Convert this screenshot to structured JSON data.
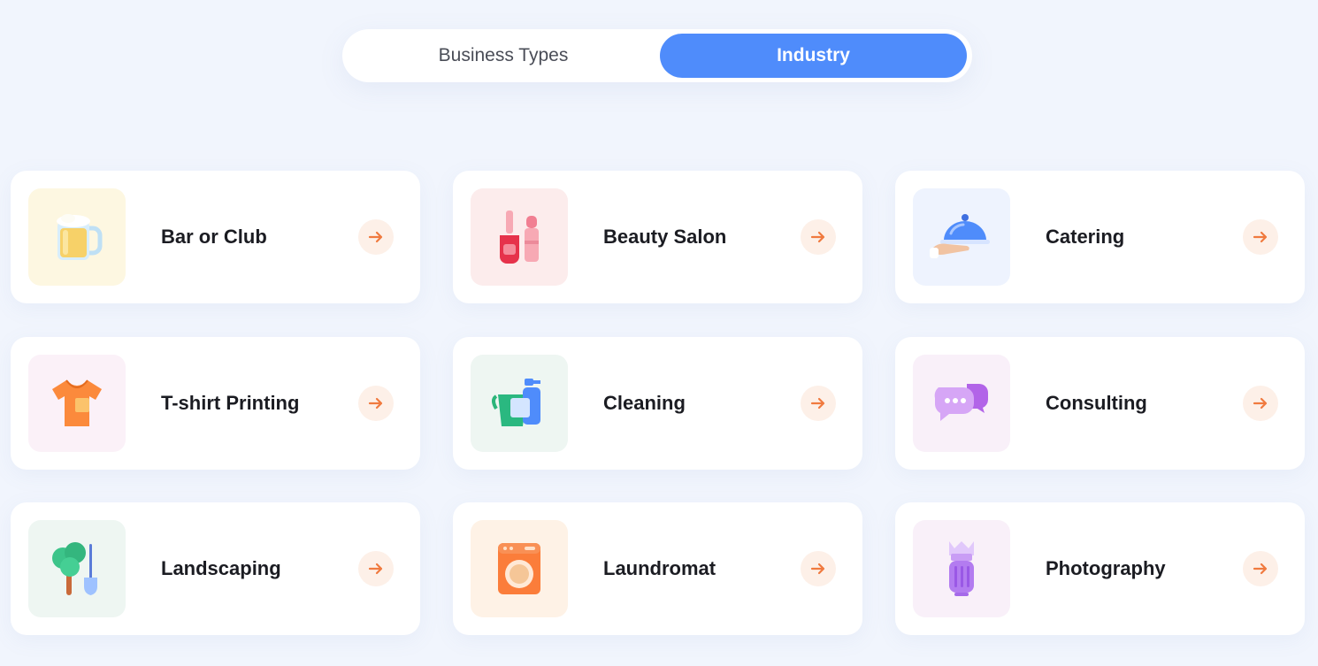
{
  "toggle": {
    "tabs": [
      {
        "label": "Business Types",
        "active": false
      },
      {
        "label": "Industry",
        "active": true
      }
    ],
    "active_color": "#4f8cfb"
  },
  "accent_arrow_color": "#f07a3f",
  "cards": [
    {
      "label": "Bar or Club",
      "icon": "beer-mug-icon",
      "tile_color": "#fdf7e1"
    },
    {
      "label": "Beauty Salon",
      "icon": "nail-polish-lipstick-icon",
      "tile_color": "#fcecec"
    },
    {
      "label": "Catering",
      "icon": "serving-cloche-icon",
      "tile_color": "#eef3fe"
    },
    {
      "label": "T-shirt Printing",
      "icon": "tshirt-icon",
      "tile_color": "#fbf1f8"
    },
    {
      "label": "Cleaning",
      "icon": "cleaning-bucket-spray-icon",
      "tile_color": "#eef6f2"
    },
    {
      "label": "Consulting",
      "icon": "chat-bubbles-icon",
      "tile_color": "#f9f0f9"
    },
    {
      "label": "Landscaping",
      "icon": "tree-shovel-icon",
      "tile_color": "#eef6f2"
    },
    {
      "label": "Laundromat",
      "icon": "washing-machine-icon",
      "tile_color": "#fef2e6"
    },
    {
      "label": "Photography",
      "icon": "camera-lens-icon",
      "tile_color": "#f9f0f9"
    }
  ]
}
